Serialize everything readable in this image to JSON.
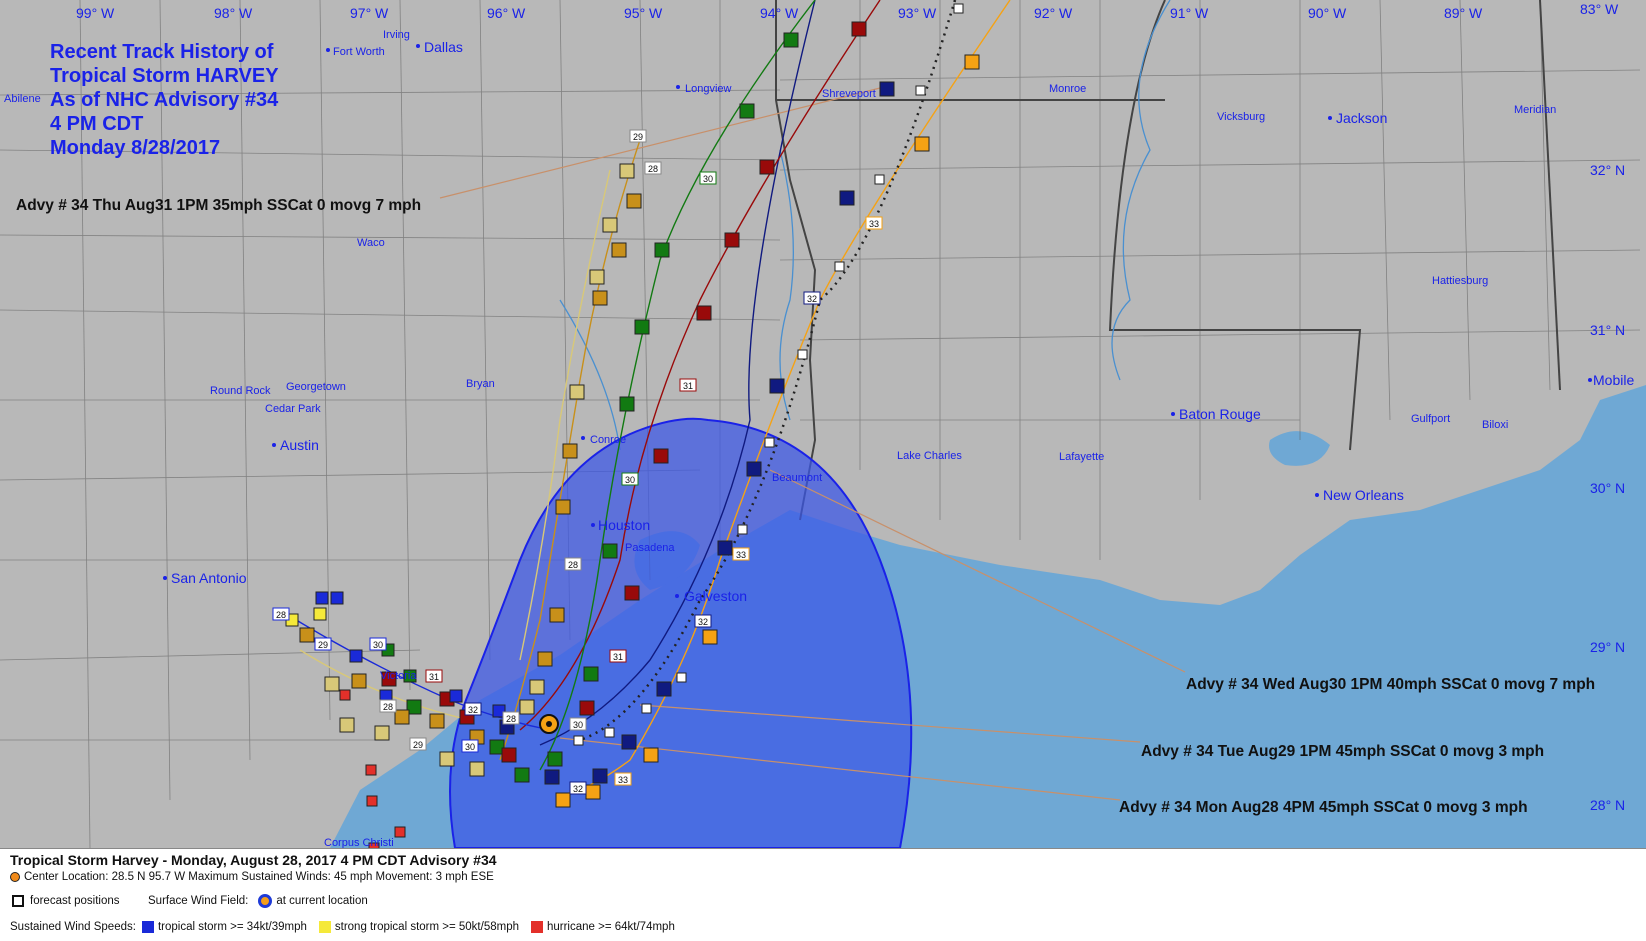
{
  "title": {
    "lines": [
      "Recent Track History of",
      "Tropical Storm HARVEY",
      "As of NHC Advisory #34",
      "4 PM CDT",
      "Monday 8/28/2017"
    ]
  },
  "longitudes": [
    "99° W",
    "98° W",
    "97° W",
    "96° W",
    "95° W",
    "94° W",
    "93° W",
    "92° W",
    "91° W",
    "90° W",
    "89° W",
    "83° W"
  ],
  "latitudes": [
    "32° N",
    "31° N",
    "30° N",
    "29° N",
    "28° N"
  ],
  "cities": [
    {
      "name": "Dallas",
      "size": "big"
    },
    {
      "name": "Irving",
      "size": "small"
    },
    {
      "name": "Fort Worth",
      "size": "small"
    },
    {
      "name": "Abilene",
      "size": "small"
    },
    {
      "name": "Longview",
      "size": "small"
    },
    {
      "name": "Shreveport",
      "size": "small"
    },
    {
      "name": "Monroe",
      "size": "small"
    },
    {
      "name": "Vicksburg",
      "size": "small"
    },
    {
      "name": "Jackson",
      "size": "big"
    },
    {
      "name": "Meridian",
      "size": "small"
    },
    {
      "name": "Hattiesburg",
      "size": "small"
    },
    {
      "name": "Mobile",
      "size": "big"
    },
    {
      "name": "Waco",
      "size": "small"
    },
    {
      "name": "Round Rock",
      "size": "small"
    },
    {
      "name": "Georgetown",
      "size": "small"
    },
    {
      "name": "Cedar Park",
      "size": "small"
    },
    {
      "name": "Austin",
      "size": "big"
    },
    {
      "name": "Bryan",
      "size": "small"
    },
    {
      "name": "Conroe",
      "size": "small"
    },
    {
      "name": "Houston",
      "size": "big"
    },
    {
      "name": "Pasadena",
      "size": "small"
    },
    {
      "name": "Galveston",
      "size": "big"
    },
    {
      "name": "Beaumont",
      "size": "small"
    },
    {
      "name": "Lake Charles",
      "size": "small"
    },
    {
      "name": "Lafayette",
      "size": "small"
    },
    {
      "name": "Baton Rouge",
      "size": "big"
    },
    {
      "name": "New Orleans",
      "size": "big"
    },
    {
      "name": "Gulfport",
      "size": "small"
    },
    {
      "name": "Biloxi",
      "size": "small"
    },
    {
      "name": "San Antonio",
      "size": "big"
    },
    {
      "name": "Victoria",
      "size": "small"
    },
    {
      "name": "Corpus Christi",
      "size": "small"
    }
  ],
  "advisory_labels": [
    "Advy # 34 Thu Aug31 1PM  35mph SSCat 0 movg 7 mph",
    "Advy # 34 Wed Aug30 1PM  40mph SSCat 0 movg 7 mph",
    "Advy # 34 Tue Aug29 1PM  45mph SSCat 0 movg 3 mph",
    "Advy # 34 Mon Aug28 4PM  45mph SSCat 0 movg 3 mph"
  ],
  "day_labels": [
    "28",
    "29",
    "30",
    "31",
    "32",
    "33"
  ],
  "legend": {
    "title": "Tropical Storm Harvey  -  Monday, August 28, 2017  4 PM CDT   Advisory #34",
    "center": "Center Location: 28.5 N  95.7 W   Maximum Sustained Winds: 45 mph  Movement: 3 mph ESE",
    "forecast": "forecast positions",
    "surface_wind": "Surface Wind Field:",
    "current": "at current location",
    "sustained": "Sustained Wind Speeds:",
    "ts": "tropical storm >= 34kt/39mph",
    "sts": "strong tropical storm >= 50kt/58mph",
    "hu": "hurricane >= 64kt/74mph"
  },
  "colors": {
    "land": "#b8b8b8",
    "water": "#6fa8d4",
    "border": "#333333",
    "title": "#1a22e8",
    "wind_field": "#3a56e8",
    "ts_blue": "#1a2ad8",
    "sts_yellow": "#f5e93a",
    "hu_red": "#e3302a",
    "navy": "#101a80",
    "orange": "#f5a214",
    "darkred": "#990a0a",
    "green": "#127a12",
    "gold": "#c8901a",
    "khaki": "#d8c878"
  }
}
